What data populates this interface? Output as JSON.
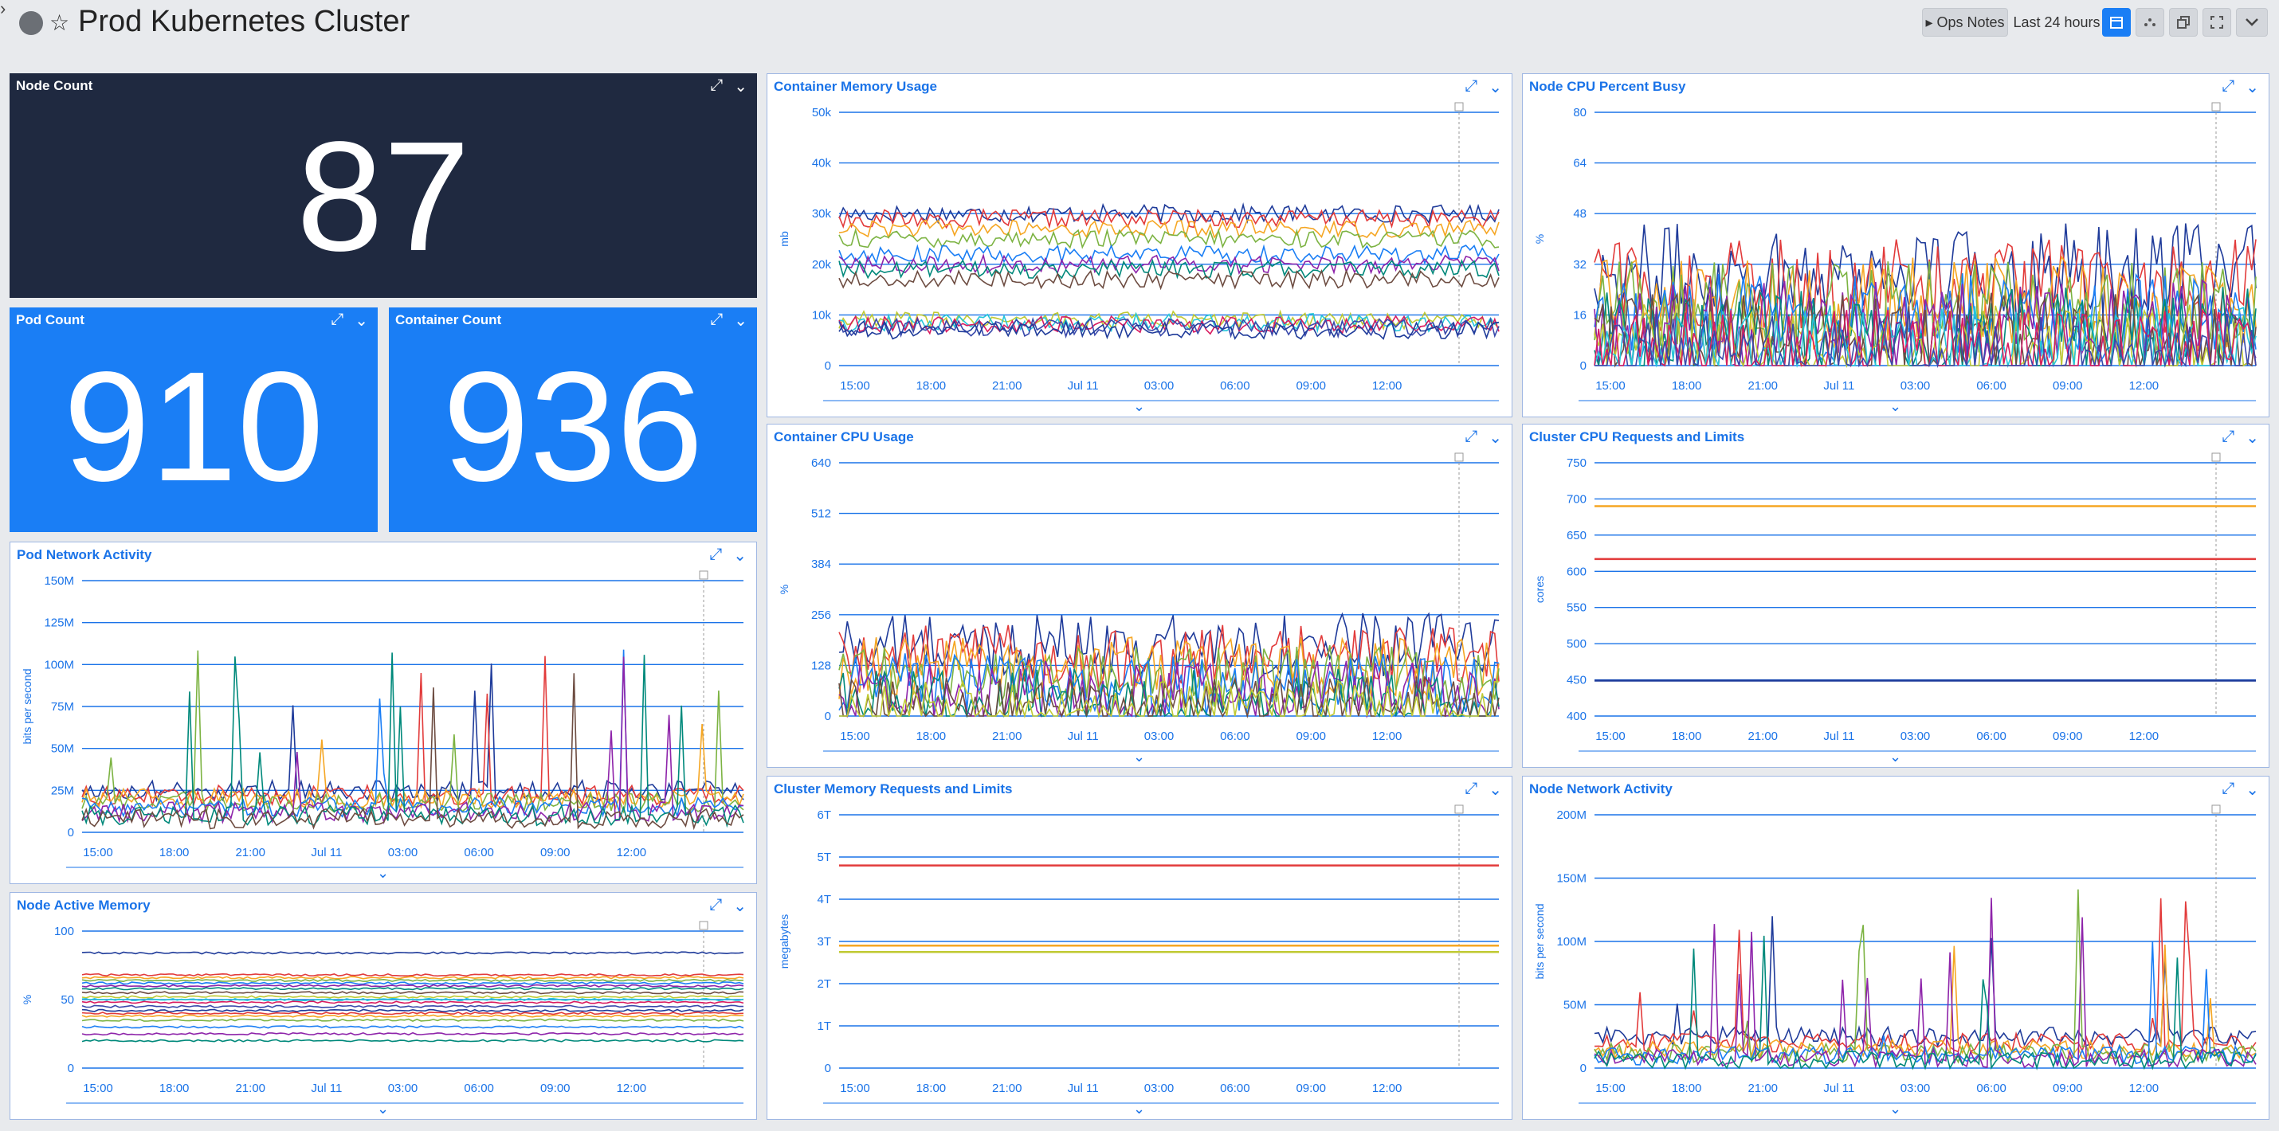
{
  "topbar": {
    "title": "Prod Kubernetes Cluster",
    "star": "☆",
    "sidebar_toggle": "›",
    "ops_notes": "▸ Ops Notes",
    "time_range": "Last 24 hours",
    "icons": [
      "calendar-icon",
      "graph-settings-icon",
      "clone-icon",
      "fullscreen-icon",
      "chevron-down-icon"
    ]
  },
  "big_numbers": {
    "node_count": {
      "title": "Node Count",
      "value": "87"
    },
    "pod_count": {
      "title": "Pod Count",
      "value": "910"
    },
    "container_count": {
      "title": "Container Count",
      "value": "936"
    }
  },
  "colors": {
    "accent": "#1a7ef5",
    "dark_widget": "#1f2940",
    "grid": "#1a73e8",
    "series": [
      "#1f3b9a",
      "#e23b3b",
      "#f5a623",
      "#7cb342",
      "#1a7ef5",
      "#8e24aa",
      "#00897b",
      "#6d4c41",
      "#c0ca33",
      "#26c6da",
      "#d81b60",
      "#3949ab"
    ]
  },
  "chart_data": [
    {
      "id": "container-memory",
      "type": "line",
      "title": "Container Memory Usage",
      "ylabel": "mb",
      "y_ticks": [
        "0",
        "10k",
        "20k",
        "30k",
        "40k",
        "50k"
      ],
      "ylim": [
        0,
        50000
      ],
      "x_ticks": [
        "15:00",
        "18:00",
        "21:00",
        "Jul 11",
        "03:00",
        "06:00",
        "09:00",
        "12:00"
      ],
      "series_levels": [
        30000,
        29000,
        27000,
        25000,
        22000,
        20000,
        19000,
        17000,
        9000,
        8500,
        8000,
        7500,
        7000
      ],
      "noise": 3500,
      "grid": true
    },
    {
      "id": "node-cpu",
      "type": "line",
      "title": "Node CPU Percent Busy",
      "ylabel": "%",
      "y_ticks": [
        "0",
        "16",
        "32",
        "48",
        "64",
        "80"
      ],
      "ylim": [
        0,
        80
      ],
      "x_ticks": [
        "15:00",
        "18:00",
        "21:00",
        "Jul 11",
        "03:00",
        "06:00",
        "09:00",
        "12:00"
      ],
      "series_levels": [
        30,
        25,
        20,
        18,
        15,
        12,
        10,
        8,
        6,
        4,
        3,
        2
      ],
      "noise": 30,
      "grid": true
    },
    {
      "id": "container-cpu",
      "type": "line",
      "title": "Container CPU Usage",
      "ylabel": "%",
      "y_ticks": [
        "0",
        "128",
        "256",
        "384",
        "512",
        "640"
      ],
      "ylim": [
        0,
        640
      ],
      "x_ticks": [
        "15:00",
        "18:00",
        "21:00",
        "Jul 11",
        "03:00",
        "06:00",
        "09:00",
        "12:00"
      ],
      "series_levels": [
        180,
        150,
        120,
        100,
        80,
        60,
        40,
        20,
        10
      ],
      "noise": 160,
      "grid": true
    },
    {
      "id": "cluster-cpu-requests",
      "type": "line",
      "title": "Cluster CPU Requests and Limits",
      "ylabel": "cores",
      "y_ticks": [
        "400",
        "450",
        "500",
        "550",
        "600",
        "650",
        "700",
        "750"
      ],
      "ylim": [
        400,
        750
      ],
      "x_ticks": [
        "15:00",
        "18:00",
        "21:00",
        "Jul 11",
        "03:00",
        "06:00",
        "09:00",
        "12:00"
      ],
      "flat_series": [
        {
          "value": 690,
          "color": "#f5a623"
        },
        {
          "value": 617,
          "color": "#e23b3b"
        },
        {
          "value": 449,
          "color": "#1f3b9a"
        }
      ],
      "grid": true
    },
    {
      "id": "pod-network",
      "type": "line",
      "title": "Pod Network Activity",
      "ylabel": "bits per second",
      "y_ticks": [
        "0",
        "25M",
        "50M",
        "75M",
        "100M",
        "125M",
        "150M"
      ],
      "ylim": [
        0,
        150
      ],
      "x_ticks": [
        "15:00",
        "18:00",
        "21:00",
        "Jul 11",
        "03:00",
        "06:00",
        "09:00",
        "12:00"
      ],
      "series_levels": [
        25,
        22,
        20,
        18,
        15,
        12,
        10,
        8
      ],
      "noise": 12,
      "spikes": true,
      "grid": true
    },
    {
      "id": "cluster-memory-requests",
      "type": "line",
      "title": "Cluster Memory Requests and Limits",
      "ylabel": "megabytes",
      "y_ticks": [
        "0",
        "1T",
        "2T",
        "3T",
        "4T",
        "5T",
        "6T"
      ],
      "ylim": [
        0,
        6
      ],
      "x_ticks": [
        "15:00",
        "18:00",
        "21:00",
        "Jul 11",
        "03:00",
        "06:00",
        "09:00",
        "12:00"
      ],
      "flat_series": [
        {
          "value": 4.8,
          "color": "#e23b3b"
        },
        {
          "value": 2.9,
          "color": "#f5a623"
        },
        {
          "value": 2.75,
          "color": "#c0ca33"
        }
      ],
      "grid": true
    },
    {
      "id": "node-network",
      "type": "line",
      "title": "Node Network Activity",
      "ylabel": "bits per second",
      "y_ticks": [
        "0",
        "50M",
        "100M",
        "150M",
        "200M"
      ],
      "ylim": [
        0,
        200
      ],
      "x_ticks": [
        "15:00",
        "18:00",
        "21:00",
        "Jul 11",
        "03:00",
        "06:00",
        "09:00",
        "12:00"
      ],
      "series_levels": [
        25,
        20,
        15,
        12,
        10,
        8,
        6
      ],
      "noise": 15,
      "spikes": true,
      "grid": true
    },
    {
      "id": "node-memory",
      "type": "line",
      "title": "Node Active Memory",
      "ylabel": "%",
      "y_ticks": [
        "0",
        "50",
        "100"
      ],
      "ylim": [
        0,
        100
      ],
      "x_ticks": [
        "15:00",
        "18:00",
        "21:00",
        "Jul 11",
        "03:00",
        "06:00",
        "09:00",
        "12:00"
      ],
      "series_levels": [
        84,
        68,
        66,
        64,
        62,
        60,
        58,
        55,
        52,
        50,
        48,
        45,
        42,
        40,
        38,
        35,
        30,
        25,
        20
      ],
      "noise": 1.5,
      "grid": true
    }
  ]
}
